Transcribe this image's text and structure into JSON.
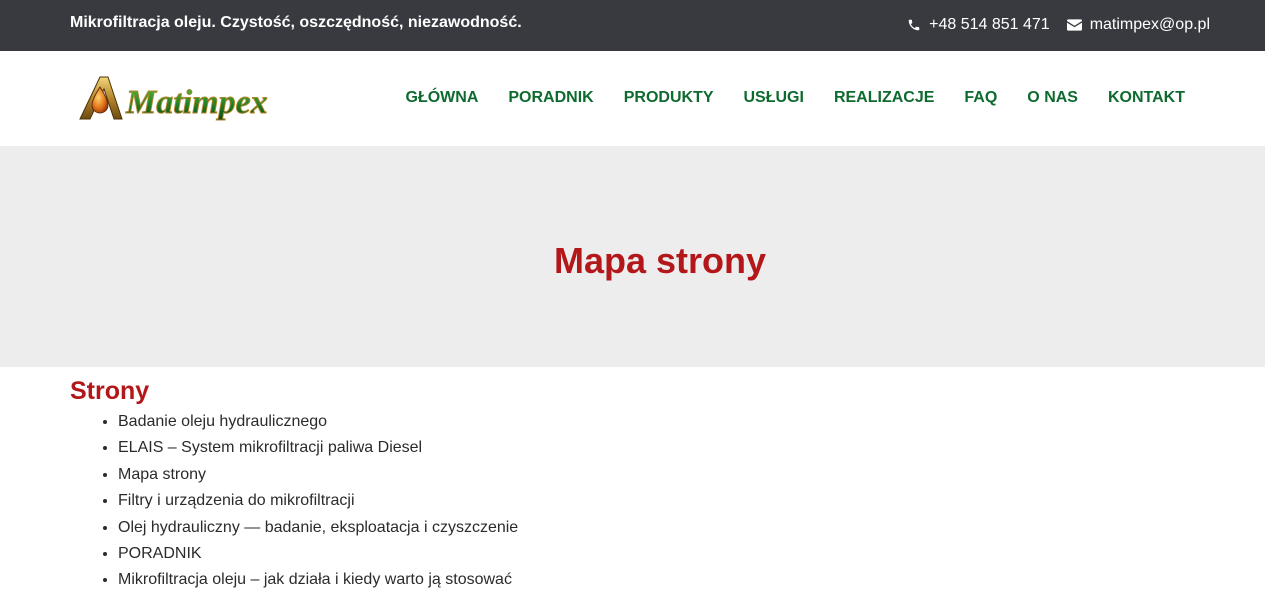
{
  "topbar": {
    "tagline": "Mikrofiltracja oleju. Czystość, oszczędność, niezawodność.",
    "phone": "+48 514 851 471",
    "email": "matimpex@op.pl",
    "background": "#383a3f"
  },
  "header": {
    "logo_text": "Matimpex",
    "nav": [
      {
        "label": "GŁÓWNA"
      },
      {
        "label": "PORADNIK"
      },
      {
        "label": "PRODUKTY"
      },
      {
        "label": "USŁUGI"
      },
      {
        "label": "REALIZACJE"
      },
      {
        "label": "FAQ"
      },
      {
        "label": "O NAS"
      },
      {
        "label": "KONTAKT"
      }
    ],
    "nav_color": "#0f6a2f"
  },
  "hero": {
    "title": "Mapa strony",
    "title_color": "#b3171a",
    "background": "#ededee"
  },
  "content": {
    "section_title": "Strony",
    "pages": [
      "Badanie oleju hydraulicznego",
      "ELAIS – System mikrofiltracji paliwa Diesel",
      "Mapa strony",
      "Filtry i urządzenia do mikrofiltracji",
      "Olej hydrauliczny — badanie, eksploatacja i czyszczenie",
      "PORADNIK",
      "Mikrofiltracja oleju – jak działa i kiedy warto ją stosować"
    ]
  },
  "icons": {
    "phone": "phone-icon",
    "email": "envelope-icon"
  }
}
